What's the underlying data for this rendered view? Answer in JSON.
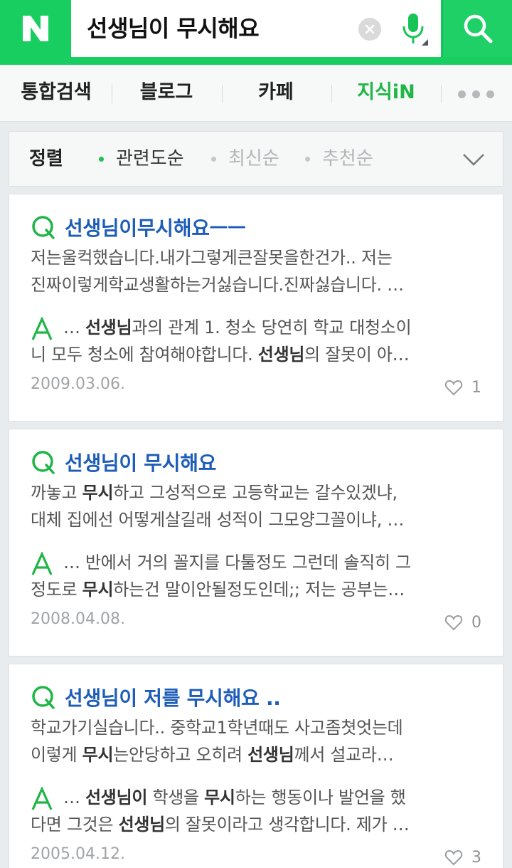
{
  "header": {
    "logo_text": "N",
    "query": "선생님이 무시해요",
    "brand_color": "#19ce60"
  },
  "tabs": [
    {
      "label": "통합검색",
      "active": false
    },
    {
      "label": "블로그",
      "active": false
    },
    {
      "label": "카페",
      "active": false
    },
    {
      "label": "지식iN",
      "active": true
    }
  ],
  "sort": {
    "title": "정렬",
    "options": [
      {
        "label": "관련도순",
        "active": true
      },
      {
        "label": "최신순",
        "active": false
      },
      {
        "label": "추천순",
        "active": false
      }
    ]
  },
  "results": [
    {
      "q_title": "선생님이무시해요ㅡㅡ",
      "q_lines": [
        [
          {
            "t": "저는울컥했습니다.내가그렇게큰잘못을한건가.. 저는",
            "b": false
          }
        ],
        [
          {
            "t": "진짜이렇게학교생활하는거싫습니다.진짜싫습니다. …",
            "b": false
          }
        ]
      ],
      "a_lines": [
        [
          {
            "t": "… ",
            "b": false
          },
          {
            "t": "선생님",
            "b": true
          },
          {
            "t": "과의 관계 1. 청소 당연히 학교 대청소이",
            "b": false
          }
        ],
        [
          {
            "t": "니 모두 청소에 참여해야합니다. ",
            "b": false
          },
          {
            "t": "선생님",
            "b": true
          },
          {
            "t": "의 잘못이 아…",
            "b": false
          }
        ]
      ],
      "date": "2009.03.06.",
      "likes": "1"
    },
    {
      "q_title": "선생님이 무시해요",
      "q_lines": [
        [
          {
            "t": "까놓고 ",
            "b": false
          },
          {
            "t": "무시",
            "b": true
          },
          {
            "t": "하고 그성적으로 고등학교는 갈수있겠냐,",
            "b": false
          }
        ],
        [
          {
            "t": "대체 집에선 어떻게살길래 성적이 그모양그꼴이냐, …",
            "b": false
          }
        ]
      ],
      "a_lines": [
        [
          {
            "t": "… 반에서 거의 꼴지를 다툴정도 그런데 솔직히 그",
            "b": false
          }
        ],
        [
          {
            "t": "정도로 ",
            "b": false
          },
          {
            "t": "무시",
            "b": true
          },
          {
            "t": "하는건 말이안될정도인데;; 저는 공부는…",
            "b": false
          }
        ]
      ],
      "date": "2008.04.08.",
      "likes": "0"
    },
    {
      "q_title": "선생님이 저를 무시해요 ..",
      "q_lines": [
        [
          {
            "t": "학교가기실습니다.. 중학교1학년때도 사고좀쳣엇는데",
            "b": false
          }
        ],
        [
          {
            "t": "이렇게 ",
            "b": false
          },
          {
            "t": "무시",
            "b": true
          },
          {
            "t": "는안당하고 오히려 ",
            "b": false
          },
          {
            "t": "선생님",
            "b": true
          },
          {
            "t": "께서 설교라…",
            "b": false
          }
        ]
      ],
      "a_lines": [
        [
          {
            "t": "… ",
            "b": false
          },
          {
            "t": "선생님이",
            "b": true
          },
          {
            "t": " 학생을 ",
            "b": false
          },
          {
            "t": "무시",
            "b": true
          },
          {
            "t": "하는 행동이나 발언을 했",
            "b": false
          }
        ],
        [
          {
            "t": "다면 그것은 ",
            "b": false
          },
          {
            "t": "선생님",
            "b": true
          },
          {
            "t": "의 잘못이라고 생각합니다. 제가 …",
            "b": false
          }
        ]
      ],
      "date": "2005.04.12.",
      "likes": "3"
    }
  ]
}
